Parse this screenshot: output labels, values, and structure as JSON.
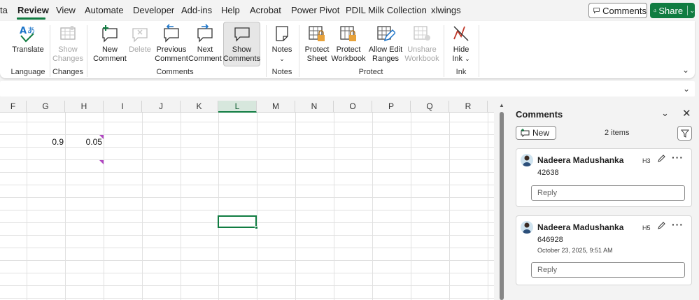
{
  "tabs": [
    "ta",
    "Review",
    "View",
    "Automate",
    "Developer",
    "Add-ins",
    "Help",
    "Acrobat",
    "Power Pivot",
    "PDIL Milk Collection",
    "xlwings"
  ],
  "active_tab": "Review",
  "top_right": {
    "comments_label": "Comments",
    "share_label": "Share"
  },
  "ribbon": {
    "translate": "Translate",
    "show_changes": [
      "Show",
      "Changes"
    ],
    "new_comment": [
      "New",
      "Comment"
    ],
    "delete": "Delete",
    "previous_comment": [
      "Previous",
      "Comment"
    ],
    "next_comment": [
      "Next",
      "Comment"
    ],
    "show_comments": [
      "Show",
      "Comments"
    ],
    "notes": "Notes",
    "protect_sheet": [
      "Protect",
      "Sheet"
    ],
    "protect_workbook": [
      "Protect",
      "Workbook"
    ],
    "allow_edit_ranges": [
      "Allow Edit",
      "Ranges"
    ],
    "unshare_workbook": [
      "Unshare",
      "Workbook"
    ],
    "hide_ink": [
      "Hide",
      "Ink"
    ],
    "groups": {
      "language": "Language",
      "changes": "Changes",
      "comments": "Comments",
      "notes": "Notes",
      "protect": "Protect",
      "ink": "Ink"
    }
  },
  "grid": {
    "columns": [
      "F",
      "G",
      "H",
      "I",
      "J",
      "K",
      "L",
      "M",
      "N",
      "O",
      "P",
      "Q",
      "R"
    ],
    "selected_column": "L",
    "cells": {
      "G_row1": "0.9",
      "H_row1": "0.05"
    }
  },
  "comments_pane": {
    "title": "Comments",
    "new_label": "New",
    "count": "2 items",
    "threads": [
      {
        "author": "Nadeera Madushanka",
        "cell": "H3",
        "body": "42638",
        "date": "",
        "reply_placeholder": "Reply"
      },
      {
        "author": "Nadeera Madushanka",
        "cell": "H5",
        "body": "646928",
        "date": "October 23, 2025, 9:51 AM",
        "reply_placeholder": "Reply"
      }
    ]
  },
  "colors": {
    "accent": "#107c41",
    "comment_marker": "#b146c2"
  }
}
